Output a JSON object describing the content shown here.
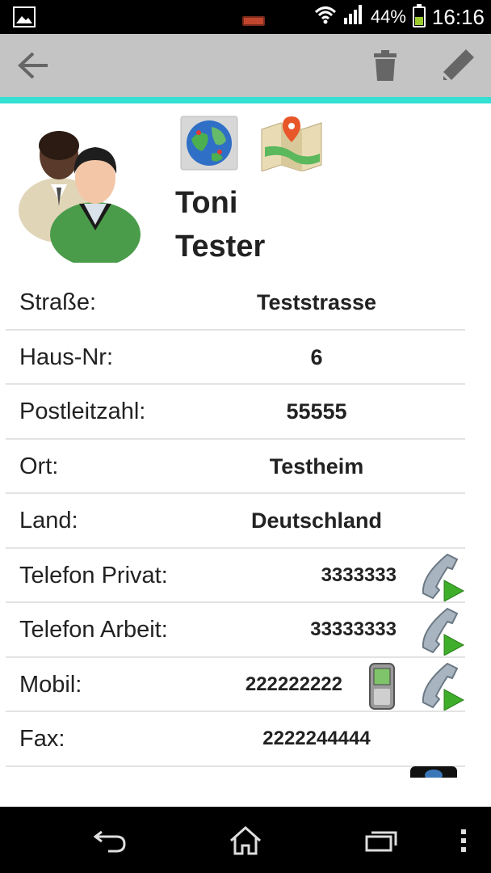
{
  "status_bar": {
    "battery_percent": "44%",
    "time": "16:16",
    "icons": [
      "image-icon",
      "battery-alert-icon",
      "wifi-icon",
      "signal-icon",
      "battery-icon"
    ]
  },
  "action_bar": {
    "icons": [
      "back-arrow-icon",
      "trash-icon",
      "pencil-icon"
    ],
    "accent_color": "#33e0d2"
  },
  "contact": {
    "first_name": "Toni",
    "last_name": "Tester",
    "icons": [
      "contacts-avatar-icon",
      "globe-icon",
      "map-icon"
    ]
  },
  "details": [
    {
      "label": "Straße:",
      "value": "Teststrasse"
    },
    {
      "label": "Haus-Nr:",
      "value": "6"
    },
    {
      "label": "Postleitzahl:",
      "value": "55555"
    },
    {
      "label": "Ort:",
      "value": "Testheim"
    },
    {
      "label": "Land:",
      "value": "Deutschland"
    },
    {
      "label": "Telefon Privat:",
      "value": "3333333"
    },
    {
      "label": "Telefon Arbeit:",
      "value": "33333333"
    },
    {
      "label": "Mobil:",
      "value": "222222222"
    },
    {
      "label": "Fax:",
      "value": "2222244444"
    }
  ],
  "nav_bar": {
    "icons": [
      "back-icon",
      "home-icon",
      "recent-apps-icon",
      "overflow-menu-icon"
    ]
  }
}
